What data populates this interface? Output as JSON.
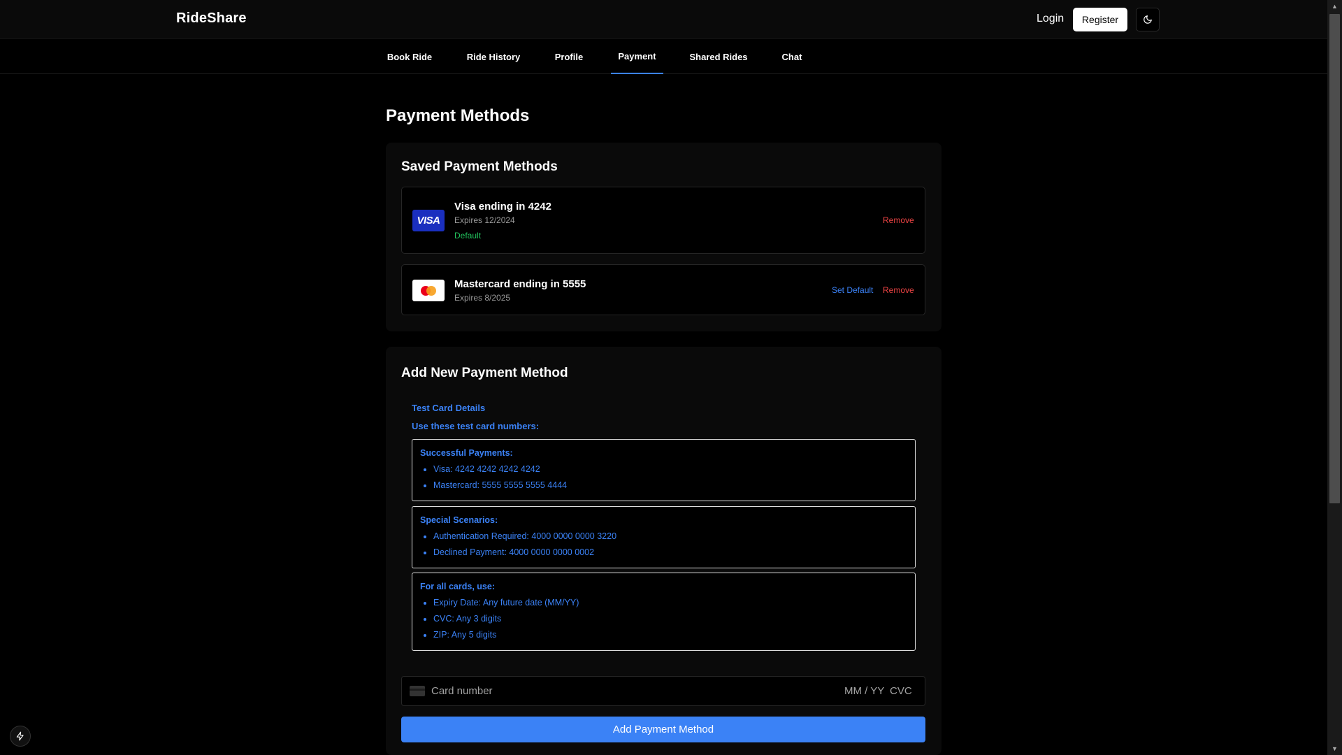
{
  "header": {
    "brand": "RideShare",
    "login_label": "Login",
    "register_label": "Register",
    "theme_icon": "moon-icon"
  },
  "nav": {
    "tabs": [
      {
        "label": "Book Ride"
      },
      {
        "label": "Ride History"
      },
      {
        "label": "Profile"
      },
      {
        "label": "Payment",
        "active": true
      },
      {
        "label": "Shared Rides"
      },
      {
        "label": "Chat"
      }
    ]
  },
  "page": {
    "title": "Payment Methods"
  },
  "saved": {
    "title": "Saved Payment Methods",
    "methods": [
      {
        "brand_logo": "VISA",
        "name": "Visa ending in 4242",
        "expires": "Expires 12/2024",
        "default_label": "Default",
        "remove_label": "Remove"
      },
      {
        "brand_logo": "mastercard-icon",
        "name": "Mastercard ending in 5555",
        "expires": "Expires 8/2025",
        "set_default_label": "Set Default",
        "remove_label": "Remove"
      }
    ]
  },
  "add": {
    "title": "Add New Payment Method",
    "test_heading": "Test Card Details",
    "test_sub": "Use these test card numbers:",
    "boxes": [
      {
        "title": "Successful Payments:",
        "items": [
          "Visa: 4242 4242 4242 4242",
          "Mastercard: 5555 5555 5555 4444"
        ]
      },
      {
        "title": "Special Scenarios:",
        "items": [
          "Authentication Required: 4000 0000 0000 3220",
          "Declined Payment: 4000 0000 0000 0002"
        ]
      },
      {
        "title": "For all cards, use:",
        "items": [
          "Expiry Date: Any future date (MM/YY)",
          "CVC: Any 3 digits",
          "ZIP: Any 5 digits"
        ]
      }
    ],
    "card_input": {
      "placeholder": "Card number",
      "expiry_placeholder": "MM / YY",
      "cvc_placeholder": "CVC"
    },
    "submit_label": "Add Payment Method"
  },
  "colors": {
    "accent": "#3b82f6",
    "danger": "#ef4444",
    "success": "#22c55e",
    "background": "#000000"
  }
}
